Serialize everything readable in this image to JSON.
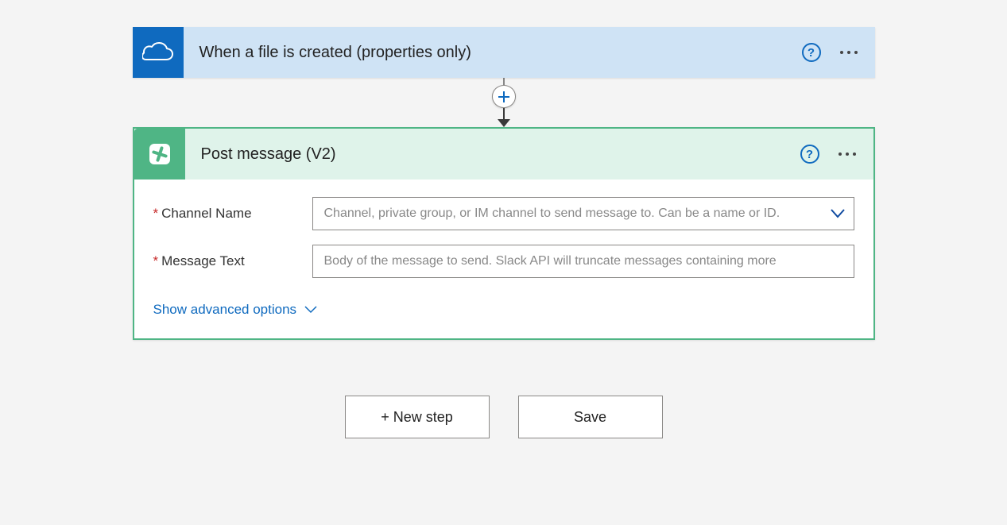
{
  "trigger": {
    "title": "When a file is created (properties only)"
  },
  "action": {
    "title": "Post message (V2)",
    "fields": {
      "channel_label": "Channel Name",
      "channel_placeholder": "Channel, private group, or IM channel to send message to. Can be a name or ID.",
      "message_label": "Message Text",
      "message_placeholder": "Body of the message to send. Slack API will truncate messages containing more"
    },
    "advanced_text": "Show advanced options"
  },
  "footer": {
    "new_step": "+ New step",
    "save": "Save"
  }
}
